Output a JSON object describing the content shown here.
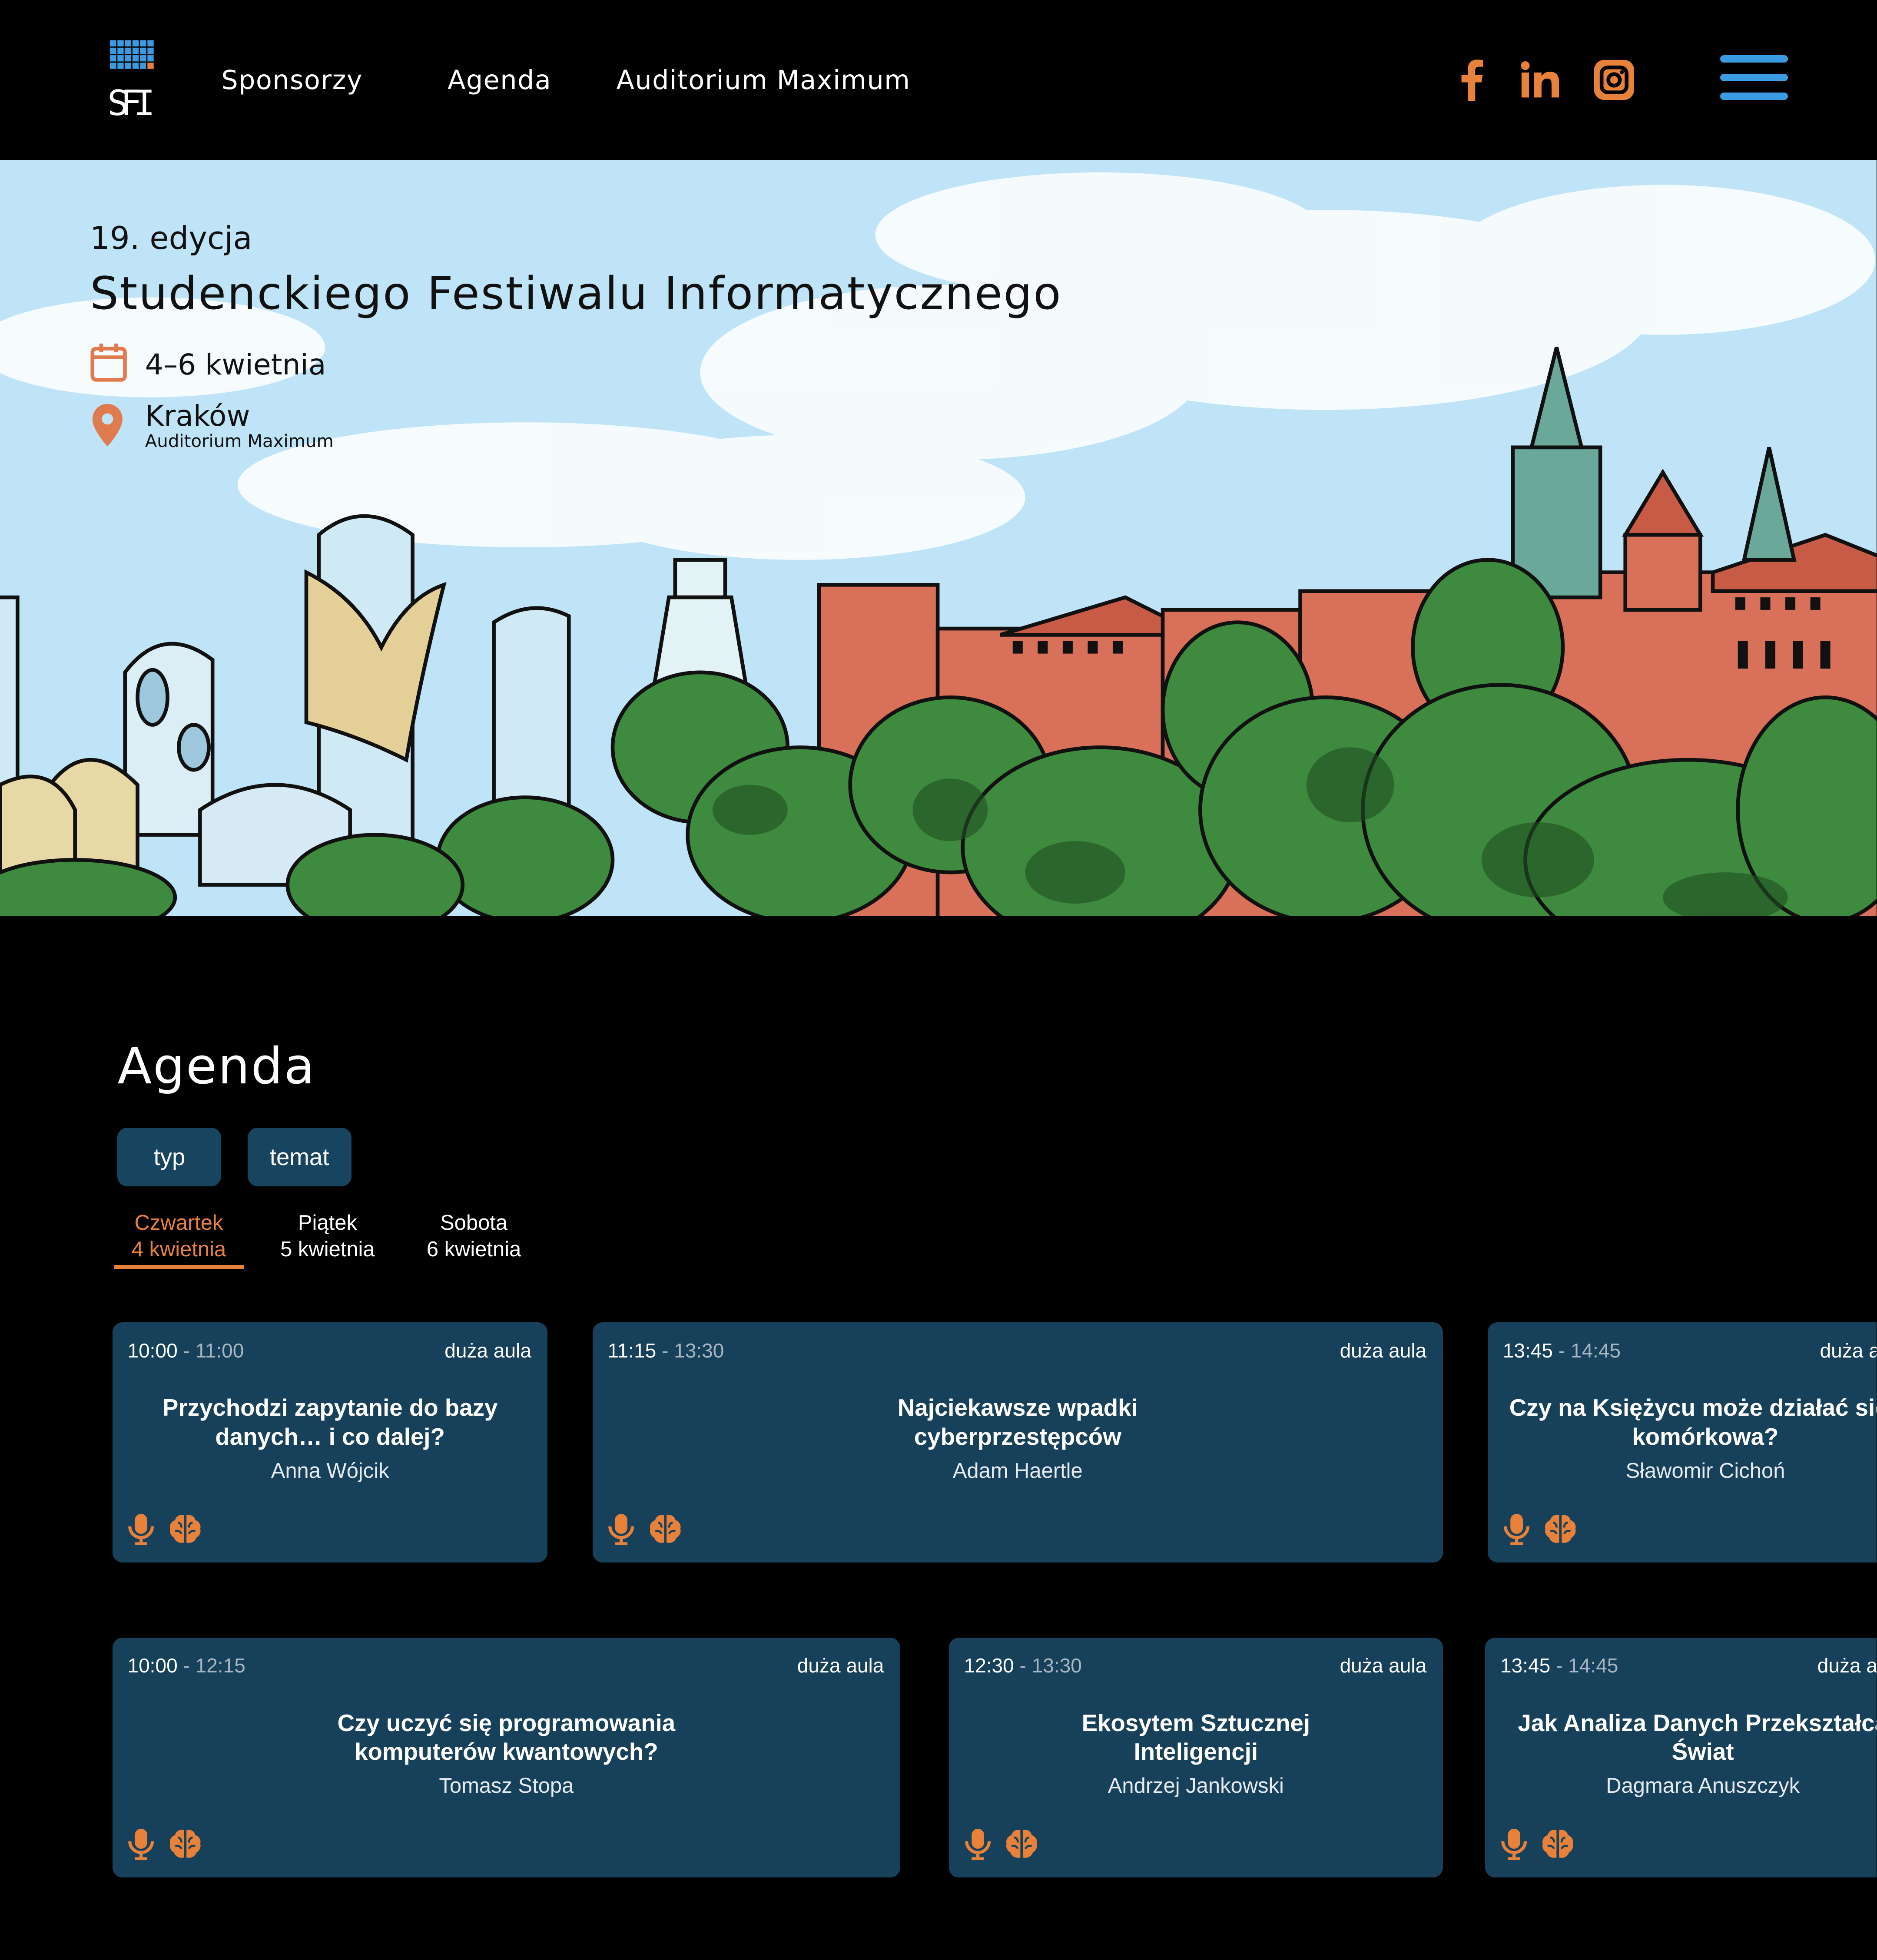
{
  "header": {
    "logo_text": "SFI",
    "nav": [
      "Sponsorzy",
      "Agenda",
      "Auditorium Maximum"
    ],
    "social": [
      "facebook-icon",
      "linkedin-icon",
      "instagram-icon"
    ],
    "accent_color": "#e8823a",
    "menu_color": "#3a9be0"
  },
  "hero": {
    "edition": "19. edycja",
    "title": "Studenckiego Festiwalu Informatycznego",
    "dates": "4–6 kwietnia",
    "city": "Kraków",
    "venue": "Auditorium Maximum"
  },
  "agenda": {
    "title": "Agenda",
    "filters": [
      "typ",
      "temat"
    ],
    "days": [
      {
        "day": "Czwartek",
        "date": "4 kwietnia",
        "active": true
      },
      {
        "day": "Piątek",
        "date": "5 kwietnia",
        "active": false
      },
      {
        "day": "Sobota",
        "date": "6 kwietnia",
        "active": false
      }
    ],
    "rows": [
      [
        {
          "start": "10:00",
          "end": "11:00",
          "room": "duża aula",
          "title": "Przychodzi zapytanie do bazy danych… i co dalej?",
          "speaker": "Anna Wójcik"
        },
        {
          "start": "11:15",
          "end": "13:30",
          "room": "duża aula",
          "title": "Najciekawsze wpadki cyberprzestępców",
          "speaker": "Adam Haertle"
        },
        {
          "start": "13:45",
          "end": "14:45",
          "room": "duża aula",
          "title": "Czy na Księżycu może działać sieć komórkowa?",
          "speaker": "Sławomir Cichoń"
        }
      ],
      [
        {
          "start": "10:00",
          "end": "12:15",
          "room": "duża aula",
          "title": "Czy uczyć się programowania komputerów kwantowych?",
          "speaker": "Tomasz Stopa"
        },
        {
          "start": "12:30",
          "end": "13:30",
          "room": "duża aula",
          "title": "Ekosytem Sztucznej Inteligencji",
          "speaker": "Andrzej Jankowski"
        },
        {
          "start": "13:45",
          "end": "14:45",
          "room": "duża aula",
          "title": "Jak Analiza Danych Przekształca Świat",
          "speaker": "Dagmara Anuszczyk"
        }
      ]
    ],
    "card_icons": [
      "microphone-icon",
      "brain-icon"
    ],
    "card_color": "#17405a"
  }
}
